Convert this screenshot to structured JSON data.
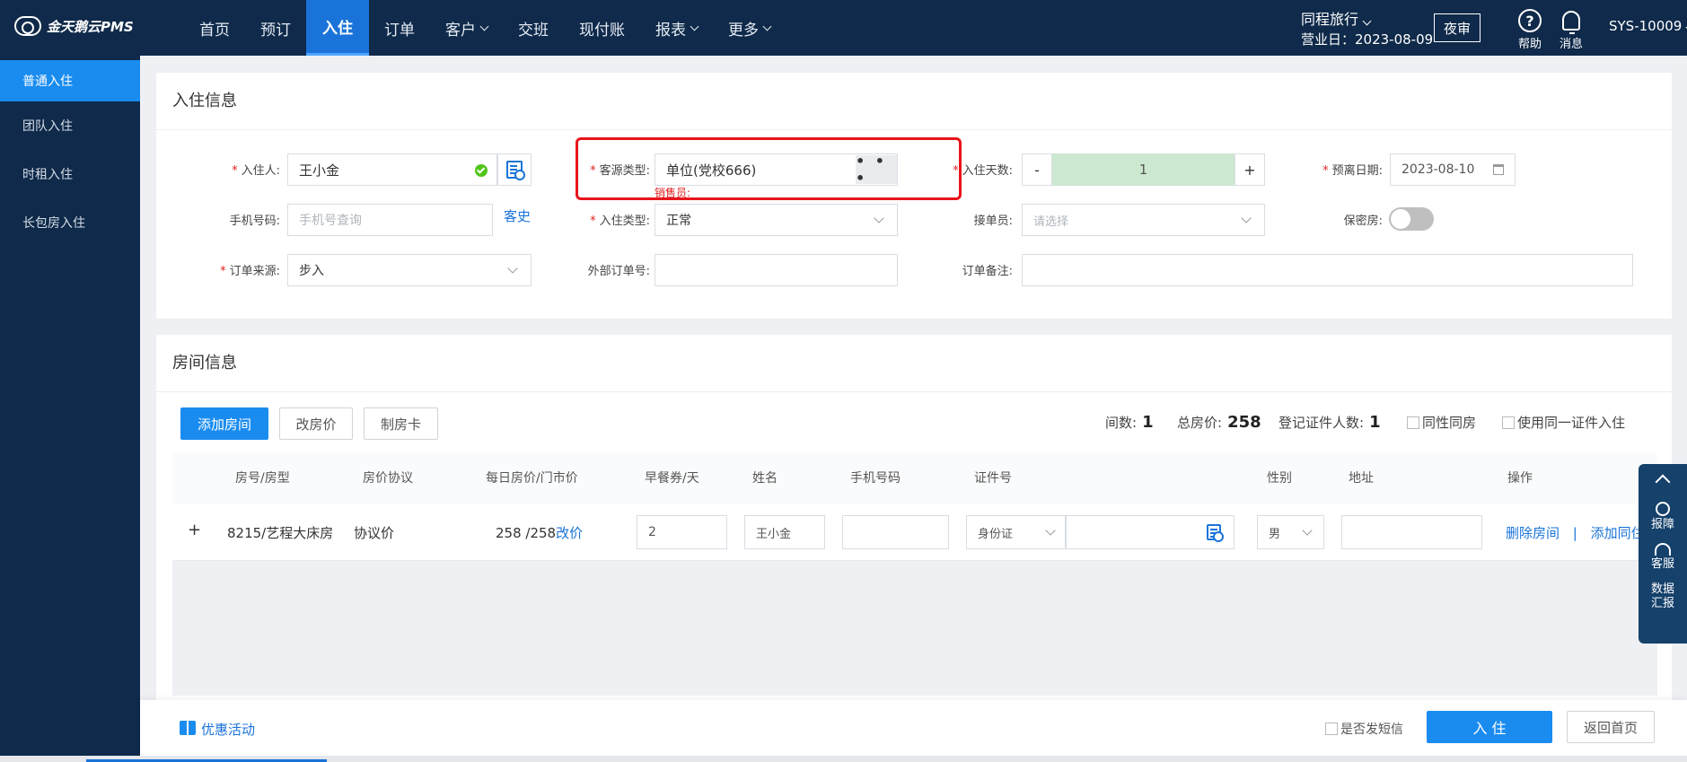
{
  "header": {
    "logo": "金天鹅云PMS",
    "nav": [
      "首页",
      "预订",
      "入住",
      "订单",
      "客户",
      "交班",
      "现付账",
      "报表",
      "更多"
    ],
    "nav_dropdowns": [
      "客户",
      "报表",
      "更多"
    ],
    "active_nav": "入住",
    "company": "同程旅行",
    "business_date": "营业日：2023-08-09",
    "night_audit": "夜审",
    "help": "帮助",
    "messages": "消息",
    "user": "SYS-10009"
  },
  "sidebar": {
    "items": [
      "普通入住",
      "团队入住",
      "时租入住",
      "长包房入住"
    ],
    "active": "普通入住"
  },
  "checkin": {
    "title": "入住信息",
    "guest_label": "入住人:",
    "guest_value": "王小金",
    "source_label": "客源类型:",
    "source_value": "单位(党校666)",
    "more": "• • •",
    "sales_label": "销售员:",
    "days_label": "入住天数:",
    "minus": "-",
    "days_value": "1",
    "plus": "+",
    "departure_label": "预离日期:",
    "departure_value": "2023-08-10",
    "phone_label": "手机号码:",
    "phone_placeholder": "手机号查询",
    "history_link": "客史",
    "checkin_type_label": "入住类型:",
    "checkin_type_value": "正常",
    "receiver_label": "接单员:",
    "receiver_placeholder": "请选择",
    "secret_label": "保密房:",
    "secret_on": false,
    "order_source_label": "订单来源:",
    "order_source_value": "步入",
    "external_order_label": "外部订单号:",
    "remark_label": "订单备注:"
  },
  "rooms": {
    "title": "房间信息",
    "add_room": "添加房间",
    "change_price": "改房价",
    "make_card": "制房卡",
    "rooms_count_label": "间数:",
    "rooms_count": "1",
    "total_price_label": "总房价:",
    "total_price": "258",
    "id_count_label": "登记证件人数:",
    "id_count": "1",
    "same_gender": "同性同房",
    "same_id": "使用同一证件入住",
    "columns": [
      "房号/房型",
      "房价协议",
      "每日房价/门市价",
      "早餐券/天",
      "姓名",
      "手机号码",
      "证件号",
      "性别",
      "地址",
      "操作"
    ],
    "row": {
      "expand": "+",
      "room": "8215/艺程大床房",
      "agreement": "协议价",
      "price": "258 /258",
      "change": "改价",
      "breakfast": "2",
      "name": "王小金",
      "phone": "",
      "id_type": "身份证",
      "gender": "男",
      "delete": "删除房间",
      "separator": "|",
      "add_guest": "添加同住"
    }
  },
  "float_bar": {
    "report": "报障",
    "service": "客服",
    "data_line1": "数据",
    "data_line2": "汇报"
  },
  "footer": {
    "promo": "优惠活动",
    "send_sms": "是否发短信",
    "checkin_btn": "入 住",
    "back_btn": "返回首页"
  },
  "colors": {
    "nav_bg": "#0f2a4a",
    "primary": "#1a8cf0",
    "highlight": "#e8141b",
    "stepper_bg": "#cde8d0"
  }
}
